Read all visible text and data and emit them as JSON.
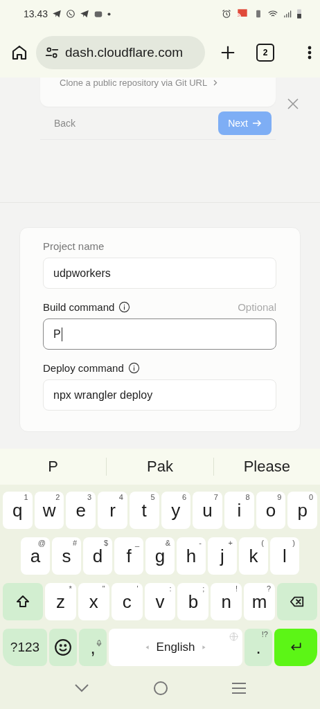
{
  "status_bar": {
    "time": "13.43"
  },
  "browser": {
    "url": "dash.cloudflare.com",
    "tab_count": "2"
  },
  "previous_step": {
    "link": "Clone a public repository via Git URL",
    "back": "Back",
    "next": "Next",
    "next_disabled": true
  },
  "form": {
    "fields": [
      {
        "label": "Project name",
        "value": "udpworkers",
        "info": false,
        "focused": false
      },
      {
        "label": "Build command",
        "value": "P",
        "info": true,
        "optional": "Optional",
        "focused": true
      },
      {
        "label": "Deploy command",
        "value": "npx wrangler deploy",
        "info": true,
        "focused": false
      }
    ]
  },
  "suggestions": [
    "P",
    "Pak",
    "Please"
  ],
  "keyboard": {
    "rows": [
      {
        "keys": [
          {
            "kind": "letter",
            "label": "q",
            "hint": "1"
          },
          {
            "kind": "letter",
            "label": "w",
            "hint": "2"
          },
          {
            "kind": "letter",
            "label": "e",
            "hint": "3"
          },
          {
            "kind": "letter",
            "label": "r",
            "hint": "4"
          },
          {
            "kind": "letter",
            "label": "t",
            "hint": "5"
          },
          {
            "kind": "letter",
            "label": "y",
            "hint": "6"
          },
          {
            "kind": "letter",
            "label": "u",
            "hint": "7"
          },
          {
            "kind": "letter",
            "label": "i",
            "hint": "8"
          },
          {
            "kind": "letter",
            "label": "o",
            "hint": "9"
          },
          {
            "kind": "letter",
            "label": "p",
            "hint": "0"
          }
        ]
      },
      {
        "keys": [
          {
            "kind": "letter",
            "label": "a",
            "hint": "@"
          },
          {
            "kind": "letter",
            "label": "s",
            "hint": "#"
          },
          {
            "kind": "letter",
            "label": "d",
            "hint": "$"
          },
          {
            "kind": "letter",
            "label": "f",
            "hint": "_"
          },
          {
            "kind": "letter",
            "label": "g",
            "hint": "&"
          },
          {
            "kind": "letter",
            "label": "h",
            "hint": "-"
          },
          {
            "kind": "letter",
            "label": "j",
            "hint": "+"
          },
          {
            "kind": "letter",
            "label": "k",
            "hint": "("
          },
          {
            "kind": "letter",
            "label": "l",
            "hint": ")"
          }
        ]
      },
      {
        "keys": [
          {
            "kind": "shift"
          },
          {
            "kind": "letter",
            "label": "z",
            "hint": "*"
          },
          {
            "kind": "letter",
            "label": "x",
            "hint": "\""
          },
          {
            "kind": "letter",
            "label": "c",
            "hint": "'"
          },
          {
            "kind": "letter",
            "label": "v",
            "hint": ":"
          },
          {
            "kind": "letter",
            "label": "b",
            "hint": ";"
          },
          {
            "kind": "letter",
            "label": "n",
            "hint": "!"
          },
          {
            "kind": "letter",
            "label": "m",
            "hint": "?"
          },
          {
            "kind": "backspace"
          }
        ]
      },
      {
        "keys": [
          {
            "kind": "symbols",
            "label": "?123"
          },
          {
            "kind": "emoji"
          },
          {
            "kind": "comma",
            "label": ","
          },
          {
            "kind": "space",
            "label": "English"
          },
          {
            "kind": "period",
            "label": ".",
            "hint": "!?"
          },
          {
            "kind": "enter"
          }
        ]
      }
    ]
  }
}
